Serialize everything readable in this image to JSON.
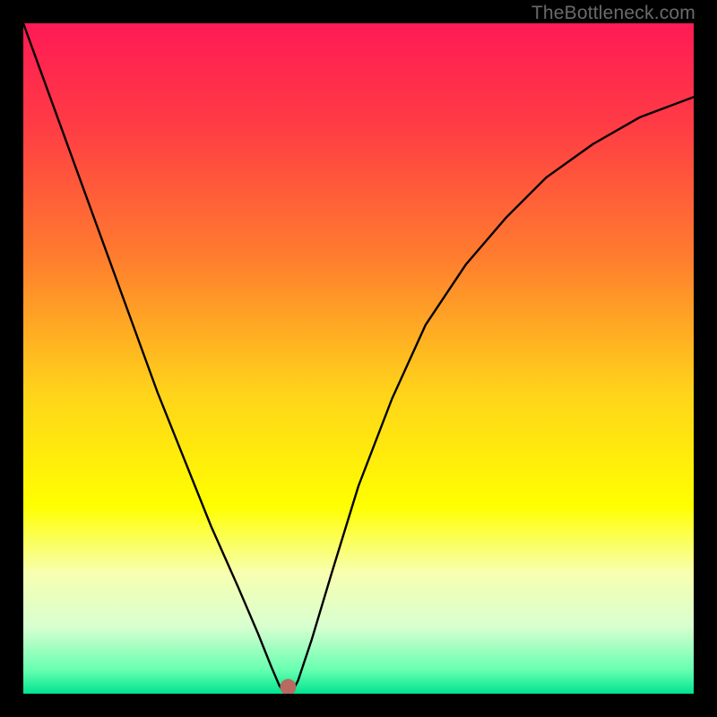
{
  "watermark": "TheBottleneck.com",
  "chart_data": {
    "type": "line",
    "title": "",
    "xlabel": "",
    "ylabel": "",
    "xlim": [
      0,
      100
    ],
    "ylim": [
      0,
      100
    ],
    "gradient_stops": [
      {
        "offset": 0,
        "color": "#ff1a55"
      },
      {
        "offset": 0.15,
        "color": "#ff3b45"
      },
      {
        "offset": 0.35,
        "color": "#ff7d2e"
      },
      {
        "offset": 0.55,
        "color": "#ffd31a"
      },
      {
        "offset": 0.72,
        "color": "#ffff00"
      },
      {
        "offset": 0.82,
        "color": "#f7ffb0"
      },
      {
        "offset": 0.9,
        "color": "#d8ffd0"
      },
      {
        "offset": 0.965,
        "color": "#66ffb0"
      },
      {
        "offset": 1.0,
        "color": "#00e38f"
      }
    ],
    "minimum_point": {
      "x": 39,
      "y": 0
    },
    "marker": {
      "x": 39.5,
      "y": 1,
      "color": "#b86a60",
      "radius": 1.2
    },
    "series": [
      {
        "name": "curve",
        "x": [
          0,
          4,
          8,
          12,
          16,
          20,
          24,
          28,
          32,
          35,
          37,
          38.2,
          39,
          40,
          41,
          43,
          46,
          50,
          55,
          60,
          66,
          72,
          78,
          85,
          92,
          100
        ],
        "y": [
          100,
          89,
          78,
          67,
          56,
          45,
          35,
          25,
          16,
          9,
          4,
          1.2,
          0,
          0,
          2,
          8,
          18,
          31,
          44,
          55,
          64,
          71,
          77,
          82,
          86,
          89
        ]
      }
    ]
  }
}
